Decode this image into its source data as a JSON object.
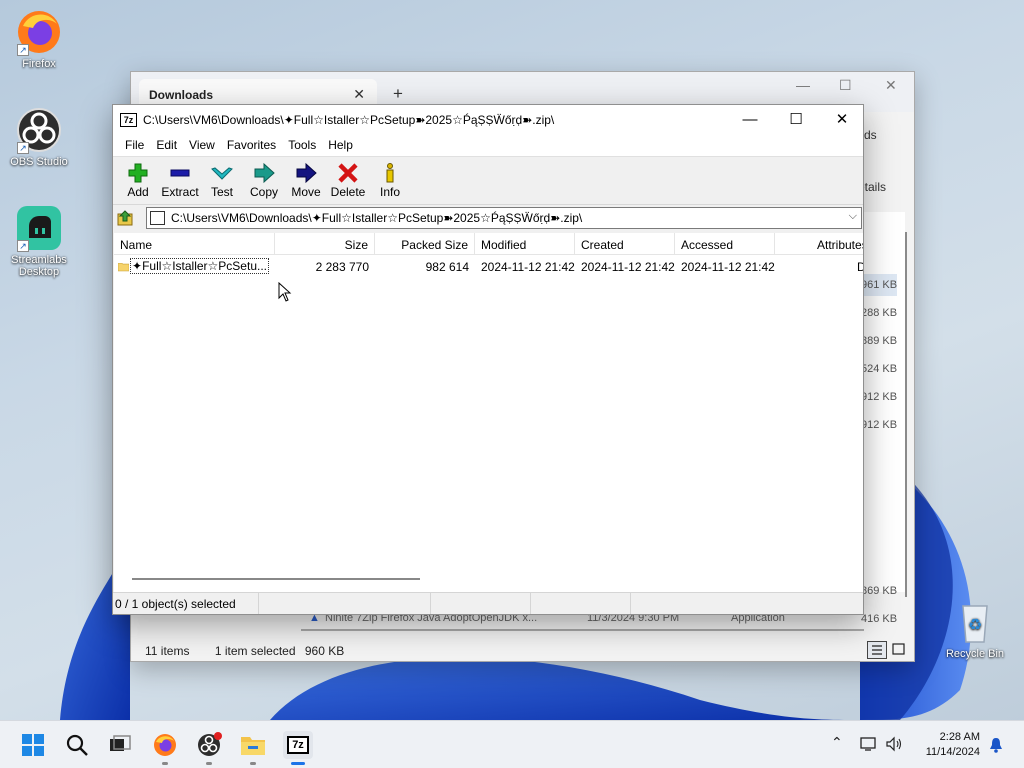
{
  "desktop": {
    "icons": [
      {
        "label": "Firefox"
      },
      {
        "label": "OBS Studio"
      },
      {
        "label": "Streamlabs Desktop"
      },
      {
        "label": "Recycle Bin"
      }
    ]
  },
  "explorer": {
    "tab_label": "Downloads",
    "side_text_ds": "ds",
    "side_text_details": "etails",
    "sizes": [
      "961 KB",
      "288 KB",
      "889 KB",
      "524 KB",
      "912 KB",
      "912 KB",
      "869 KB",
      "416 KB"
    ],
    "row_behind": {
      "name": "Ninite 7Zip Firefox Java AdoptOpenJDK x...",
      "date": "11/3/2024 9:30 PM",
      "type": "Application"
    },
    "status_items": "11 items",
    "status_selected": "1 item selected",
    "status_size": "960 KB"
  },
  "zip": {
    "title": "C:\\Users\\VM6\\Downloads\\✦Full☆Istaller☆PcSetup➽2025☆ṔąṢṢẄőṛḍ➽.zip\\",
    "title_icon": "7z",
    "menu": [
      "File",
      "Edit",
      "View",
      "Favorites",
      "Tools",
      "Help"
    ],
    "toolbar": [
      {
        "label": "Add",
        "icon": "plus-icon",
        "color": "#1fa81f"
      },
      {
        "label": "Extract",
        "icon": "minus-icon",
        "color": "#1a1a9a"
      },
      {
        "label": "Test",
        "icon": "check-icon",
        "color": "#1aa0a0"
      },
      {
        "label": "Copy",
        "icon": "copy-arrow-icon",
        "color": "#1a8a7a"
      },
      {
        "label": "Move",
        "icon": "move-arrow-icon",
        "color": "#1a1a7a"
      },
      {
        "label": "Delete",
        "icon": "delete-x-icon",
        "color": "#d01010"
      },
      {
        "label": "Info",
        "icon": "info-icon",
        "color": "#c8a800"
      }
    ],
    "address": "C:\\Users\\VM6\\Downloads\\✦Full☆Istaller☆PcSetup➽2025☆ṔąṢṢẄőṛḍ➽.zip\\",
    "columns": [
      "Name",
      "Size",
      "Packed Size",
      "Modified",
      "Created",
      "Accessed",
      "Attributes"
    ],
    "rows": [
      {
        "name": "✦Full☆Istaller☆PcSetu...",
        "size": "2 283 770",
        "packed": "982 614",
        "modified": "2024-11-12 21:42",
        "created": "2024-11-12 21:42",
        "accessed": "2024-11-12 21:42",
        "attributes": "D"
      }
    ],
    "status": [
      "0 / 1 object(s) selected",
      "",
      "",
      ""
    ]
  },
  "taskbar": {
    "time": "2:28 AM",
    "date": "11/14/2024",
    "active_app": "7z"
  }
}
